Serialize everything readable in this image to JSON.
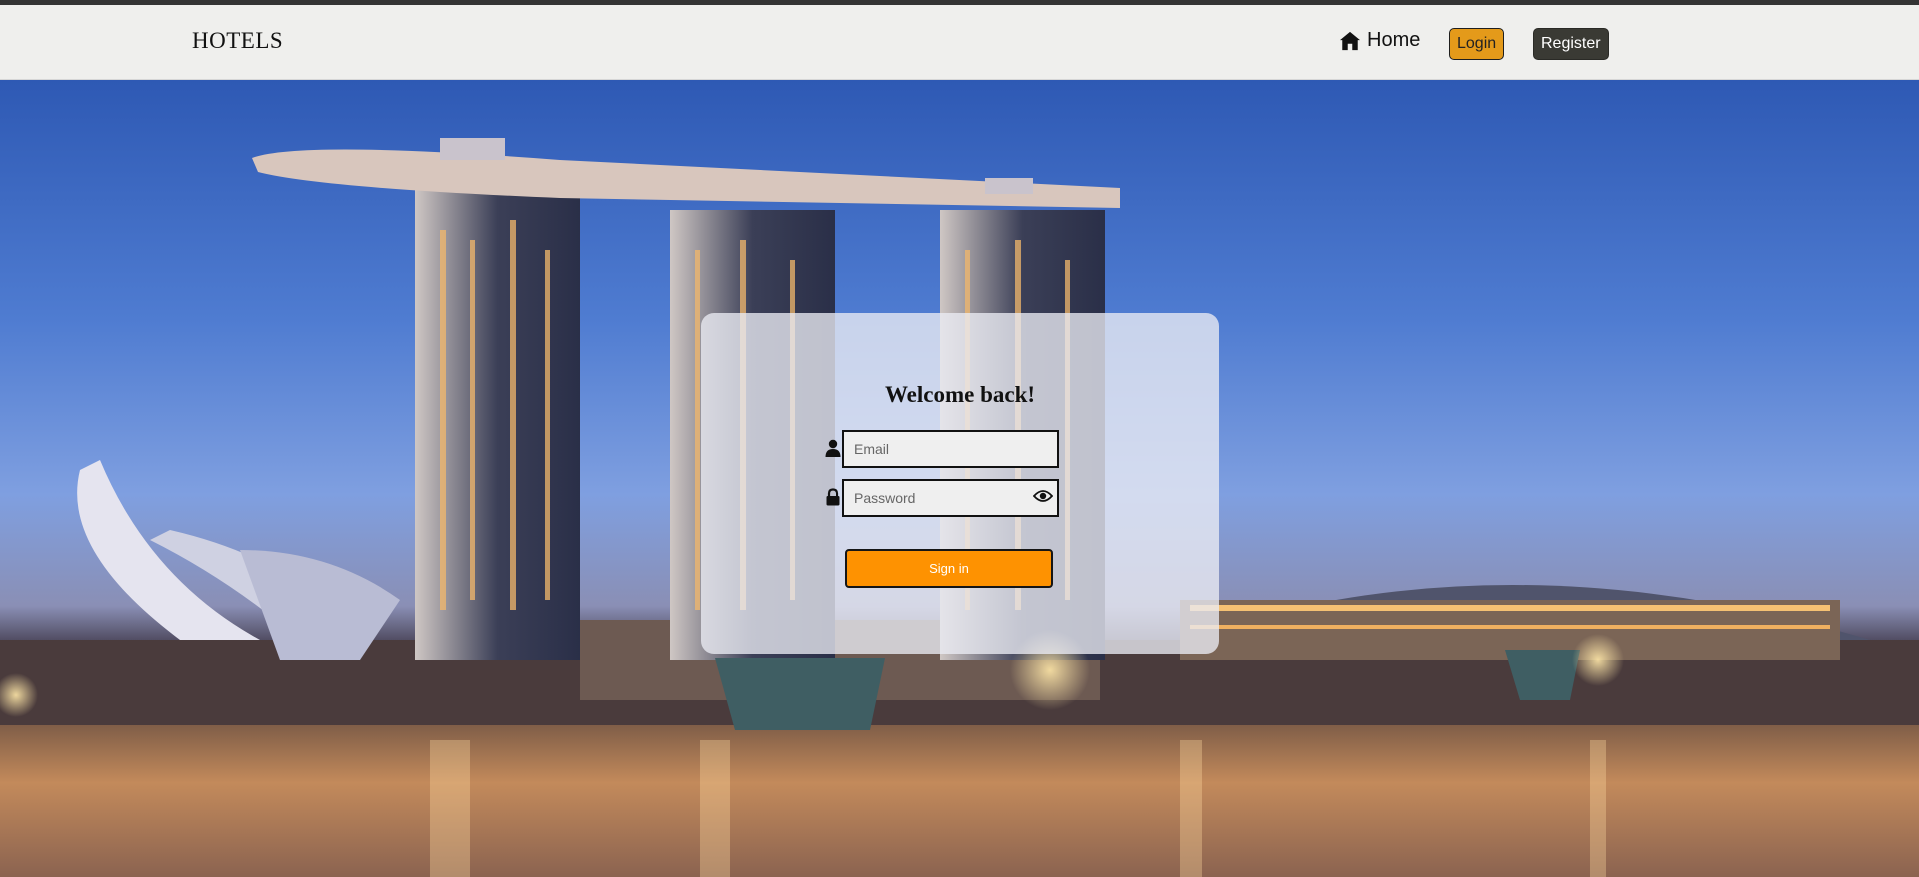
{
  "navbar": {
    "brand": "HOTELS",
    "home_label": "Home",
    "login_label": "Login",
    "register_label": "Register"
  },
  "login_form": {
    "title": "Welcome back!",
    "email_placeholder": "Email",
    "password_placeholder": "Password",
    "submit_label": "Sign in"
  },
  "colors": {
    "accent_orange": "#fe9201",
    "login_button": "#e49a1a",
    "register_button": "#3a3a34",
    "navbar_bg": "#efefed"
  },
  "icons": [
    "home-icon",
    "user-icon",
    "lock-icon",
    "eye-icon"
  ],
  "background": "city skyline photo of a hotel with three towers and a rooftop deck at dusk over water"
}
